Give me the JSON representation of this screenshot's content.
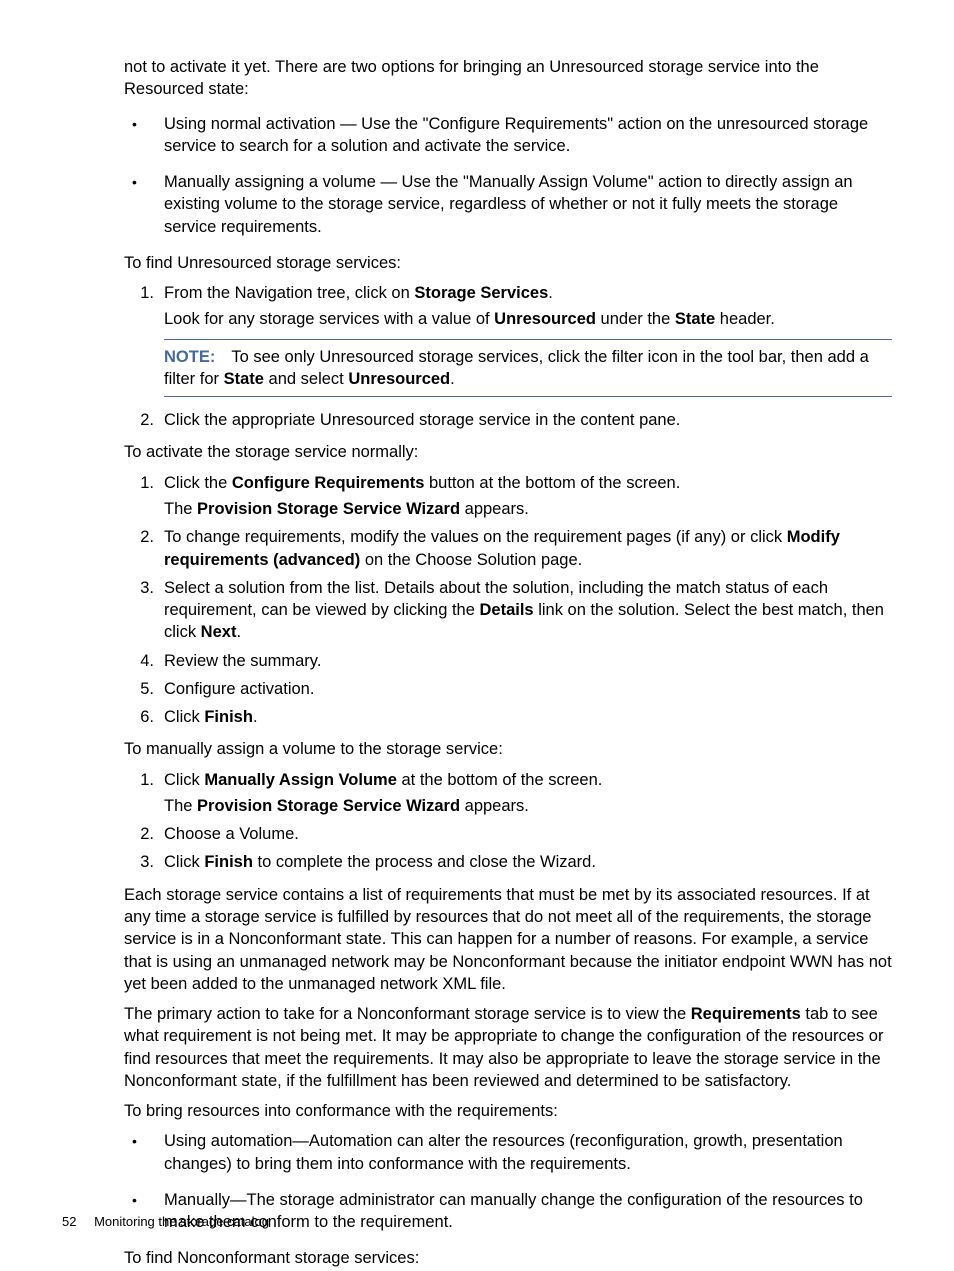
{
  "intro": "not to activate it yet. There are two options for bringing an Unresourced storage service into the Resourced state:",
  "options": [
    "Using normal activation — Use the \"Configure Requirements\" action on the unresourced storage service to search for a solution and activate the service.",
    "Manually assigning a volume — Use the \"Manually Assign Volume\" action to directly assign an existing volume to the storage service, regardless of whether or not it fully meets the storage service requirements."
  ],
  "find_intro": "To find Unresourced storage services:",
  "find_steps": {
    "s1a": "From the Navigation tree, click on ",
    "s1b": "Storage Services",
    "s1c": ".",
    "s1_sub_a": "Look for any storage services with a value of ",
    "s1_sub_b": "Unresourced",
    "s1_sub_c": " under the ",
    "s1_sub_d": "State",
    "s1_sub_e": " header.",
    "s2": "Click the appropriate Unresourced storage service in the content pane."
  },
  "note": {
    "label": "NOTE:",
    "t1": "To see only Unresourced storage services, click the filter icon in the tool bar, then add a filter for ",
    "t2": "State",
    "t3": " and select ",
    "t4": "Unresourced",
    "t5": "."
  },
  "activate_intro": "To activate the storage service normally:",
  "activate": {
    "s1a": "Click the ",
    "s1b": "Configure Requirements",
    "s1c": " button at the bottom of the screen.",
    "s1_sub_a": "The ",
    "s1_sub_b": "Provision Storage Service Wizard",
    "s1_sub_c": " appears.",
    "s2a": "To change requirements, modify the values on the requirement pages (if any) or click ",
    "s2b": "Modify requirements (advanced)",
    "s2c": " on the Choose Solution page.",
    "s3a": "Select a solution from the list. Details about the solution, including the match status of each requirement, can be viewed by clicking the ",
    "s3b": "Details",
    "s3c": " link on the solution. Select the best match, then click ",
    "s3d": "Next",
    "s3e": ".",
    "s4": "Review the summary.",
    "s5": "Configure activation.",
    "s6a": "Click ",
    "s6b": "Finish",
    "s6c": "."
  },
  "manual_intro": "To manually assign a volume to the storage service:",
  "manual": {
    "s1a": "Click ",
    "s1b": "Manually Assign Volume",
    "s1c": " at the bottom of the screen.",
    "s1_sub_a": "The ",
    "s1_sub_b": "Provision Storage Service Wizard",
    "s1_sub_c": " appears.",
    "s2": "Choose a Volume.",
    "s3a": "Click ",
    "s3b": "Finish",
    "s3c": " to complete the process and close the Wizard."
  },
  "para1": "Each storage service contains a list of requirements that must be met by its associated resources. If at any time a storage service is fulfilled by resources that do not meet all of the requirements, the storage service is in a Nonconformant state. This can happen for a number of reasons. For example, a service that is using an unmanaged network may be Nonconformant because the initiator endpoint WWN has not yet been added to the unmanaged network XML file.",
  "para2a": "The primary action to take for a Nonconformant storage service is to view the ",
  "para2b": "Requirements",
  "para2c": " tab to see what requirement is not being met. It may be appropriate to change the configuration of the resources or find resources that meet the requirements. It may also be appropriate to leave the storage service in the Nonconformant state, if the fulfillment has been reviewed and determined to be satisfactory.",
  "conform_intro": "To bring resources into conformance with the requirements:",
  "conform_opts": [
    "Using automation—Automation can alter the resources (reconfiguration, growth, presentation changes) to bring them into conformance with the requirements.",
    "Manually—The storage administrator can manually change the configuration of the resources to make them conform to the requirement."
  ],
  "nonconf_intro": "To find Nonconformant storage services:",
  "footer": {
    "page": "52",
    "title": "Monitoring the storage catalog"
  }
}
